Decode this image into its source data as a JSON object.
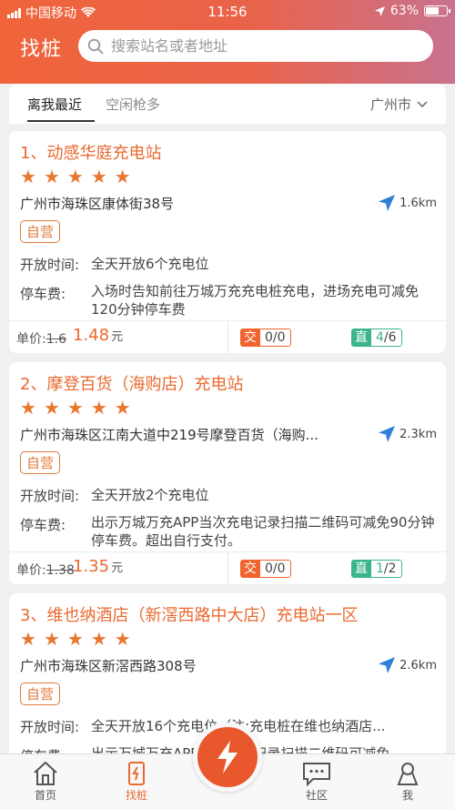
{
  "status_bar": {
    "carrier": "中国移动",
    "time": "11:56",
    "battery": "63%"
  },
  "header": {
    "title": "找桩",
    "search_placeholder": "搜索站名或者地址"
  },
  "tabs": [
    {
      "label": "离我最近"
    },
    {
      "label": "空闲枪多"
    }
  ],
  "city": "广州市",
  "labels": {
    "hours": "开放时间:",
    "parking": "停车费:",
    "price": "单价:",
    "ac": "交",
    "dc": "直"
  },
  "stations": [
    {
      "name": "1、动感华庭充电站",
      "rating": 5,
      "address": "广州市海珠区康体街38号",
      "distance": "1.6km",
      "tag": "自营",
      "hours": "全天开放6个充电位",
      "parking": "入场时告知前往万城万充充电桩充电，进场充电可减免120分钟停车费",
      "price_old": "1.6",
      "price_new": "1.48",
      "price_unit": "元",
      "ac": "0/0",
      "dc_free": "4",
      "dc_total": "/6"
    },
    {
      "name": "2、摩登百货（海购店）充电站",
      "rating": 5,
      "address": "广州市海珠区江南大道中219号摩登百货（海购...",
      "distance": "2.3km",
      "tag": "自营",
      "hours": "全天开放2个充电位",
      "parking": "出示万城万充APP当次充电记录扫描二维码可减免90分钟停车费。超出自行支付。",
      "price_old": "1.38",
      "price_new": "1.35",
      "price_unit": "元",
      "ac": "0/0",
      "dc_free": "1",
      "dc_total": "/2"
    },
    {
      "name": "3、维也纳酒店（新滘西路中大店）充电站一区",
      "rating": 5,
      "address": "广州市海珠区新滘西路308号",
      "distance": "2.6km",
      "tag": "自营",
      "hours": "全天开放16个充电位（注:充电桩在维也纳酒店...",
      "parking": "出示万城万充APP当次充电记录扫描二维码可减免"
    }
  ],
  "bottom_nav": [
    {
      "label": "首页"
    },
    {
      "label": "找桩"
    },
    {
      "label": "社区"
    },
    {
      "label": "我"
    }
  ],
  "colors": {
    "accent": "#e86a2f",
    "dc": "#3bb58a",
    "ac": "#f0642e"
  }
}
